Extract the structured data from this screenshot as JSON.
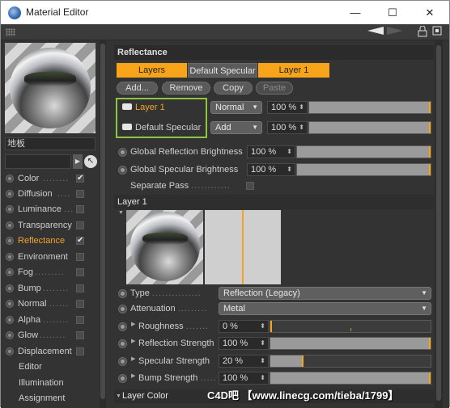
{
  "window": {
    "title": "Material Editor",
    "minimize": "—",
    "maximize": "☐",
    "close": "✕"
  },
  "toolbar": {
    "nav_left": "◀",
    "nav_right": "▶",
    "lock": "🔒",
    "expand": "⊡"
  },
  "left_panel": {
    "material_name": "地板",
    "channels": [
      {
        "label": "Color",
        "dots": "........",
        "checked": true
      },
      {
        "label": "Diffusion",
        "dots": "....",
        "checked": false
      },
      {
        "label": "Luminance",
        "dots": "...",
        "checked": false
      },
      {
        "label": "Transparency",
        "dots": "",
        "checked": false
      },
      {
        "label": "Reflectance",
        "dots": "",
        "checked": true
      },
      {
        "label": "Environment",
        "dots": "",
        "checked": false
      },
      {
        "label": "Fog",
        "dots": ".........",
        "checked": false
      },
      {
        "label": "Bump",
        "dots": "........",
        "checked": false
      },
      {
        "label": "Normal",
        "dots": "......",
        "checked": false
      },
      {
        "label": "Alpha",
        "dots": "........",
        "checked": false
      },
      {
        "label": "Glow",
        "dots": "........",
        "checked": false
      },
      {
        "label": "Displacement",
        "dots": "",
        "checked": false
      },
      {
        "label": "Editor",
        "dots": "",
        "checked": null
      },
      {
        "label": "Illumination",
        "dots": "",
        "checked": null
      },
      {
        "label": "Assignment",
        "dots": "",
        "checked": null
      }
    ],
    "check_glyph": "✔"
  },
  "reflectance": {
    "header": "Reflectance",
    "tabs": [
      "Layers",
      "Default Specular",
      "Layer 1"
    ],
    "buttons": {
      "add": "Add...",
      "remove": "Remove",
      "copy": "Copy",
      "paste": "Paste"
    },
    "layers": [
      {
        "name": "Layer 1",
        "blend": "Normal",
        "amount": "100 %",
        "amount_pct": 100
      },
      {
        "name": "Default Specular",
        "blend": "Add",
        "amount": "100 %",
        "amount_pct": 100
      }
    ],
    "global": [
      {
        "label": "Global Reflection Brightness",
        "value": "100 %",
        "pct": 100
      },
      {
        "label": "Global Specular Brightness",
        "value": "100 %",
        "pct": 100
      }
    ],
    "separate_pass": {
      "label": "Separate Pass",
      "dots": "............"
    }
  },
  "layer1": {
    "header": "Layer 1",
    "type": {
      "label": "Type",
      "dots": "...............",
      "value": "Reflection (Legacy)"
    },
    "attenuation": {
      "label": "Attenuation",
      "dots": ".........",
      "value": "Metal"
    },
    "roughness": {
      "label": "Roughness",
      "dots": ".......",
      "value": "0 %",
      "pct": 0
    },
    "reflection_strength": {
      "label": "Reflection Strength",
      "value": "100 %",
      "pct": 100
    },
    "specular_strength": {
      "label": "Specular Strength",
      "value": "20 %",
      "pct": 20
    },
    "bump_strength": {
      "label": "Bump Strength",
      "dots": ".....",
      "value": "100 %",
      "pct": 100
    },
    "layer_color": {
      "label": "Layer Color"
    }
  },
  "watermark": "C4D吧 【www.linecg.com/tieba/1799】",
  "colors": {
    "accent": "#f7a41a",
    "highlight_box": "#8dc63f",
    "panel": "#333333"
  }
}
